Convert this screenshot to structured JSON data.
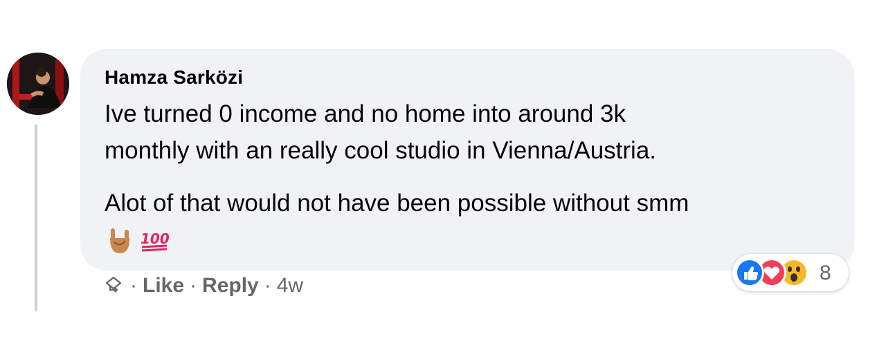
{
  "comment": {
    "author": "Hamza Sarközi",
    "body_lines": [
      "Ive turned 0 income and no home into around 3k",
      "monthly with an really cool studio in Vienna/Austria.",
      "Alot of that would not have been possible without smm"
    ],
    "emojis": [
      "sign-of-the-horns-emoji",
      "hundred-points-emoji"
    ],
    "reactions": {
      "types": [
        "like",
        "love",
        "wow"
      ],
      "count": "8",
      "colors": {
        "like": "#1877f2",
        "love": "#f33e58",
        "wow": "#f7b928"
      }
    },
    "actions": {
      "separator": "·",
      "like_label": "Like",
      "reply_label": "Reply",
      "time_ago": "4w"
    }
  },
  "theme": {
    "bubble_bg": "#f0f2f5",
    "text_color": "#050505",
    "muted_color": "#65676b"
  }
}
